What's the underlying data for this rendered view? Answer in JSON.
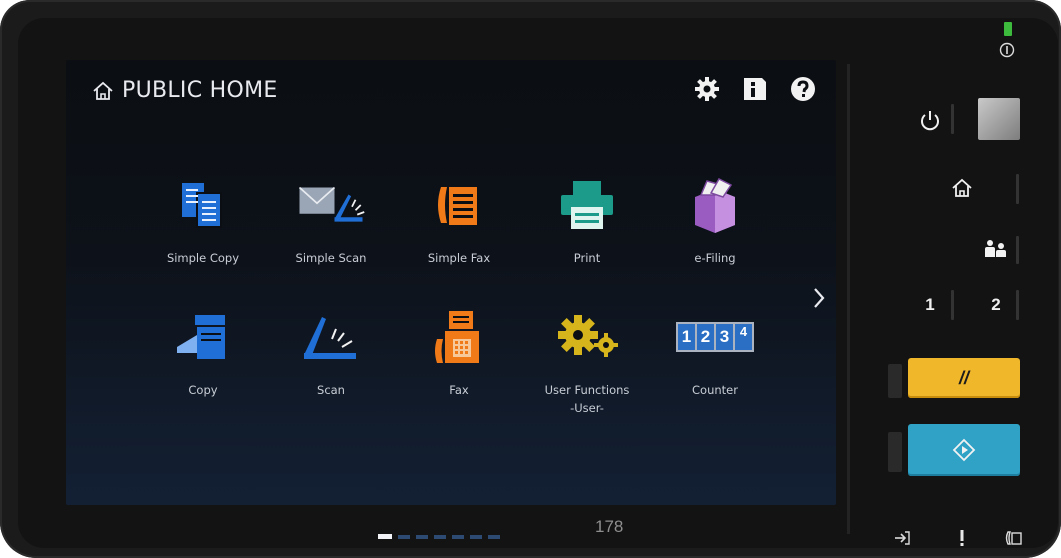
{
  "header": {
    "title": "PUBLIC HOME"
  },
  "top_icons": [
    "gear-icon",
    "info-icon",
    "help-icon"
  ],
  "tiles": [
    {
      "label": "Simple Copy",
      "icon": "simple-copy-icon"
    },
    {
      "label": "Simple Scan",
      "icon": "simple-scan-icon"
    },
    {
      "label": "Simple Fax",
      "icon": "simple-fax-icon"
    },
    {
      "label": "Print",
      "icon": "print-icon"
    },
    {
      "label": "e-Filing",
      "icon": "e-filing-icon"
    },
    {
      "label": "Copy",
      "icon": "copy-icon"
    },
    {
      "label": "Scan",
      "icon": "scan-icon"
    },
    {
      "label": "Fax",
      "icon": "fax-icon"
    },
    {
      "label": "User Functions",
      "label2": "-User-",
      "icon": "user-functions-icon"
    },
    {
      "label": "Counter",
      "icon": "counter-icon"
    }
  ],
  "counter_digits": [
    "1",
    "2",
    "3",
    "4"
  ],
  "pager": {
    "pages": 7,
    "current": 1
  },
  "side_panel": {
    "job_memory_1": "1",
    "job_memory_2": "2",
    "clear_symbol": "//"
  },
  "page_number": "178",
  "colors": {
    "tile_blue": "#1f6fd6",
    "fax_orange": "#f07a18",
    "print_teal": "#1c9a8a",
    "efiling_purple": "#9a5cc0",
    "gear_yellow": "#d6b41b",
    "clear_yellow": "#f0b72a",
    "start_blue": "#2fa2c6"
  }
}
